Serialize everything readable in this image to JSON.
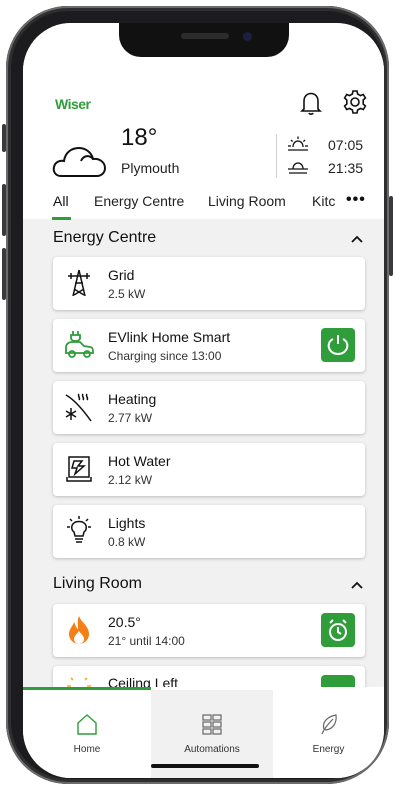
{
  "brand": {
    "logo": "Wiser",
    "accent": "#2e9d3a"
  },
  "weather": {
    "temperature": "18°",
    "city": "Plymouth",
    "sunrise": "07:05",
    "sunset": "21:35"
  },
  "tabs": [
    "All",
    "Energy Centre",
    "Living Room",
    "Kitc"
  ],
  "more_label": "•••",
  "sections": {
    "energy_centre": {
      "title": "Energy Centre",
      "items": [
        {
          "name": "Grid",
          "value": "2.5 kW",
          "icon": "pylon-icon"
        },
        {
          "name": "EVlink Home Smart",
          "value": "Charging since 13:00",
          "icon": "ev-charger-icon"
        },
        {
          "name": "Heating",
          "value": "2.77 kW",
          "icon": "heat-pump-icon"
        },
        {
          "name": "Hot Water",
          "value": "2.12 kW",
          "icon": "water-heater-icon"
        },
        {
          "name": "Lights",
          "value": "0.8 kW",
          "icon": "lightbulb-icon"
        }
      ]
    },
    "living_room": {
      "title": "Living Room",
      "items": [
        {
          "name": "20.5°",
          "value": "21° until 14:00",
          "icon": "flame-icon"
        },
        {
          "name": "Ceiling Left",
          "value": "",
          "icon": "light-icon"
        }
      ]
    }
  },
  "bottom_nav": [
    {
      "label": "Home",
      "icon": "house-icon"
    },
    {
      "label": "Automations",
      "icon": "grid-icon"
    },
    {
      "label": "Energy",
      "icon": "leaf-icon"
    }
  ]
}
